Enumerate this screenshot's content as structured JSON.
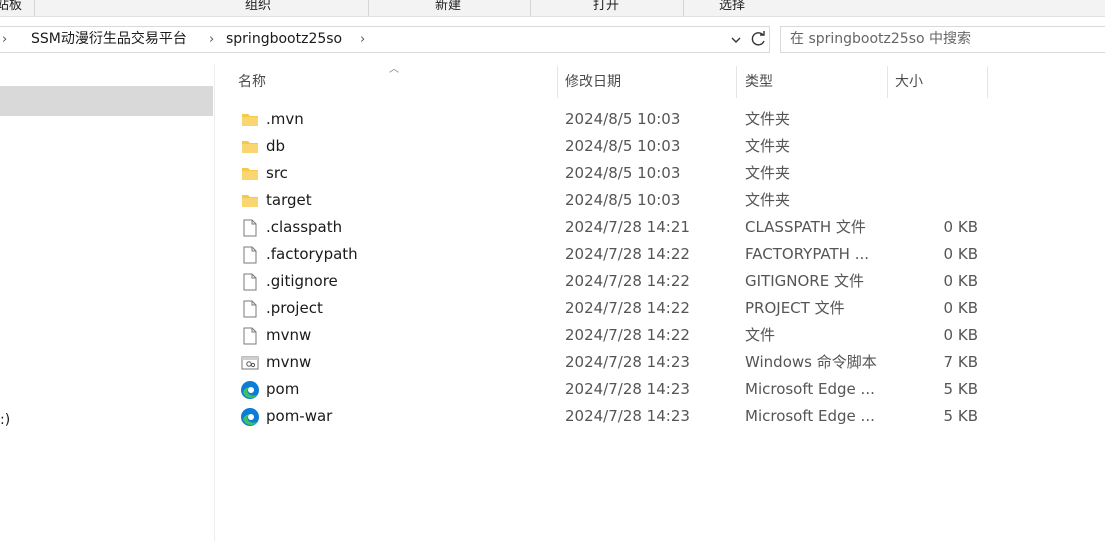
{
  "ribbon": {
    "groups": [
      "站板",
      "组织",
      "新建",
      "打开",
      "选择"
    ]
  },
  "address": {
    "crumbs": [
      "SSM动漫衍生品交易平台",
      "springbootz25so"
    ],
    "separator": "›"
  },
  "search": {
    "placeholder": "在 springbootz25so 中搜索"
  },
  "nav": {
    "drive_label": ":)"
  },
  "columns": {
    "name": "名称",
    "modified": "修改日期",
    "type": "类型",
    "size": "大小"
  },
  "files": [
    {
      "name": ".mvn",
      "date": "2024/8/5 10:03",
      "type": "文件夹",
      "size": "",
      "icon": "folder-icon"
    },
    {
      "name": "db",
      "date": "2024/8/5 10:03",
      "type": "文件夹",
      "size": "",
      "icon": "folder-icon"
    },
    {
      "name": "src",
      "date": "2024/8/5 10:03",
      "type": "文件夹",
      "size": "",
      "icon": "folder-icon"
    },
    {
      "name": "target",
      "date": "2024/8/5 10:03",
      "type": "文件夹",
      "size": "",
      "icon": "folder-icon"
    },
    {
      "name": ".classpath",
      "date": "2024/7/28 14:21",
      "type": "CLASSPATH 文件",
      "size": "0 KB",
      "icon": "file-icon"
    },
    {
      "name": ".factorypath",
      "date": "2024/7/28 14:22",
      "type": "FACTORYPATH ...",
      "size": "0 KB",
      "icon": "file-icon"
    },
    {
      "name": ".gitignore",
      "date": "2024/7/28 14:22",
      "type": "GITIGNORE 文件",
      "size": "0 KB",
      "icon": "file-icon"
    },
    {
      "name": ".project",
      "date": "2024/7/28 14:22",
      "type": "PROJECT 文件",
      "size": "0 KB",
      "icon": "file-icon"
    },
    {
      "name": "mvnw",
      "date": "2024/7/28 14:22",
      "type": "文件",
      "size": "0 KB",
      "icon": "file-icon"
    },
    {
      "name": "mvnw",
      "date": "2024/7/28 14:23",
      "type": "Windows 命令脚本",
      "size": "7 KB",
      "icon": "script-icon"
    },
    {
      "name": "pom",
      "date": "2024/7/28 14:23",
      "type": "Microsoft Edge ...",
      "size": "5 KB",
      "icon": "edge-icon"
    },
    {
      "name": "pom-war",
      "date": "2024/7/28 14:23",
      "type": "Microsoft Edge ...",
      "size": "5 KB",
      "icon": "edge-icon"
    }
  ],
  "colors": {
    "folder": "#f7c948",
    "selection": "#d9d9d9",
    "edge_blue": "#0c7cd5",
    "edge_green": "#3ec160"
  }
}
